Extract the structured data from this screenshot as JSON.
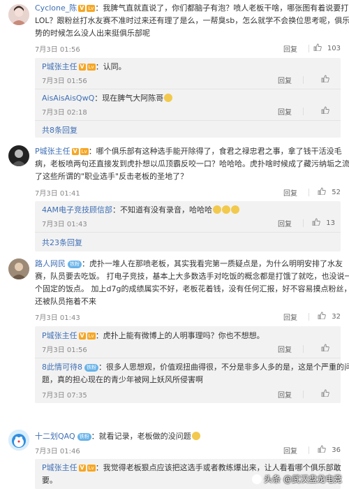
{
  "comments": [
    {
      "user": "Cyclone_陈",
      "text1": "：我脾气直就直说了，你们都脑子有泡？喷人老板干啥，哪张图有着说要打",
      "text2": "LOL？跟粉丝打水友赛不准时过来还有理了是么，一帮臭sb，怎么就学不会换位思考呢，俱乐部弱",
      "text3": "势的时候怎么没人出来挺俱乐部呢",
      "time": "7月3日 01:56",
      "reply_label": "回复",
      "likes": "103",
      "replies": [
        {
          "user": "P城张主任",
          "text": "：认同。",
          "time": "7月3日 01:56",
          "reply_label": "回复"
        },
        {
          "user": "AisAisAisQwQ",
          "text": "：现在脾气大阿陈哥",
          "time": "7月3日 02:18",
          "reply_label": "回复"
        }
      ],
      "more": "共8条回复"
    },
    {
      "user": "P城张主任",
      "text1": "：哪个俱乐部有这种选手能开除得了，食君之禄忠君之事，拿了钱干活没毛",
      "text2": "病，老板喷两句还直接发到虎扑想以瓜顶霸反咬一口？哈哈哈。虎扑啥时候成了藏污纳垢之流，成",
      "text3": "了这些所谓的\"职业选手\"反击老板的圣地了？",
      "time": "7月3日 01:41",
      "reply_label": "回复",
      "likes": "52",
      "replies": [
        {
          "user": "4AM电子竞技顾信部",
          "text": "：不知道有没有录音，哈哈哈",
          "time": "7月3日 01:43",
          "reply_label": "回复",
          "likes": "13"
        }
      ],
      "more": "共23条回复"
    },
    {
      "user": "路人网民",
      "badge": "铁粉",
      "text1": "：虎扑一堆人在那喷老板，其实我看完第一质疑点是，为什么明明安排了水友",
      "text2": "赛，队员要去吃饭。 打电子竞技，基本上大多数选手对吃饭的概念都是打饿了就吃，也没说一",
      "text3": "个固定的饭点。 加上d7g的成绩属实不好，老板花着钱，没有任何汇报，好不容易摸点粉丝，",
      "text4": "还被队员拖着不来",
      "time": "7月3日 01:43",
      "reply_label": "回复",
      "likes": "32",
      "replies": [
        {
          "user": "P城张主任",
          "text": "：虎扑上能有微博上的人明事理吗？你也不想想。",
          "time": "7月3日 01:56",
          "reply_label": "回复"
        },
        {
          "user": "8此情可待8",
          "badge": "铁粉",
          "text": "：很多人思想观，价值观扭曲得很，不分是非多人多的是，这是个严重的问",
          "text2": "题，真的担心现在的青少年被网上妖风所侵害啊",
          "time": "7月3日 07:35",
          "reply_label": "回复"
        }
      ]
    },
    {
      "user": "十二划QAQ",
      "badge": "铁粉",
      "text1": "：就看记录，老板做的没问题",
      "time": "7月3日 01:46",
      "reply_label": "回复",
      "likes": "36",
      "replies": [
        {
          "user": "P城张主任",
          "text": "：我觉得老板狠点应该把这选手或者教练爆出来，让人看看哪个俱乐部敢",
          "text2": "要。"
        }
      ]
    }
  ],
  "watermark": "头条 @武汉盘龙电竞",
  "colors": {
    "username": "#eb7350",
    "link": "#3f6fb4",
    "reply_bg": "#f2f2f2"
  }
}
